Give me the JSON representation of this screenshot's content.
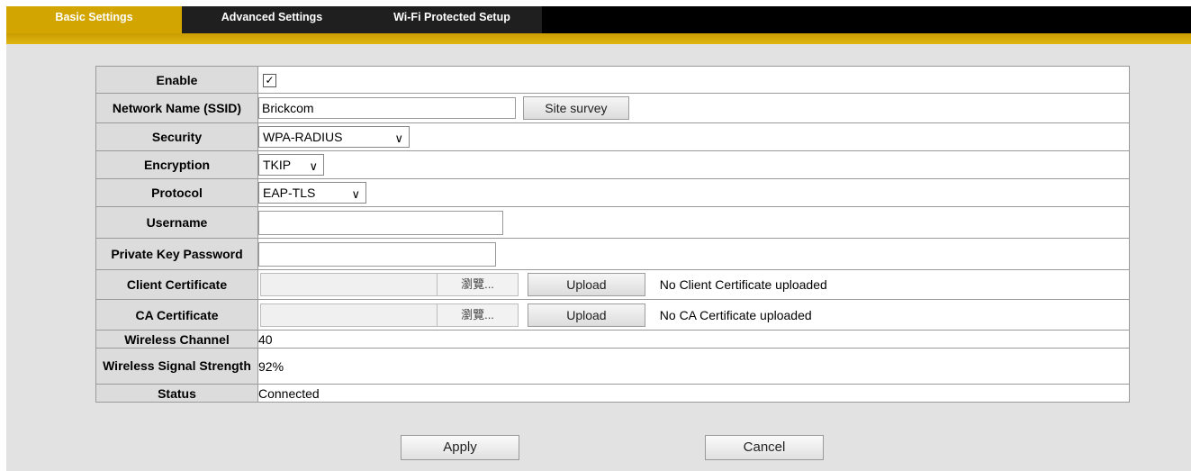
{
  "tabs": [
    {
      "label": "Basic Settings",
      "active": true
    },
    {
      "label": "Advanced Settings",
      "active": false
    },
    {
      "label": "Wi-Fi Protected Setup",
      "active": false
    }
  ],
  "colors": {
    "accent": "#d2a500",
    "tabbar": "#000000",
    "label_bg": "#dcdcdc",
    "page_bg": "#e2e2e2"
  },
  "form": {
    "enable": {
      "label": "Enable",
      "checked": true,
      "check_glyph": "✓"
    },
    "ssid": {
      "label": "Network Name (SSID)",
      "value": "Brickcom",
      "button": "Site survey"
    },
    "security": {
      "label": "Security",
      "value": "WPA-RADIUS"
    },
    "encryption": {
      "label": "Encryption",
      "value": "TKIP"
    },
    "protocol": {
      "label": "Protocol",
      "value": "EAP-TLS"
    },
    "username": {
      "label": "Username",
      "value": ""
    },
    "private_key_password": {
      "label": "Private Key Password",
      "value": ""
    },
    "client_cert": {
      "label": "Client Certificate",
      "browse": "瀏覽...",
      "upload": "Upload",
      "status": "No Client Certificate uploaded"
    },
    "ca_cert": {
      "label": "CA Certificate",
      "browse": "瀏覽...",
      "upload": "Upload",
      "status": "No CA Certificate uploaded"
    },
    "channel": {
      "label": "Wireless Channel",
      "value": "40"
    },
    "signal": {
      "label": "Wireless Signal Strength",
      "value": "92%"
    },
    "status": {
      "label": "Status",
      "value": "Connected"
    }
  },
  "footer": {
    "apply": "Apply",
    "cancel": "Cancel"
  }
}
